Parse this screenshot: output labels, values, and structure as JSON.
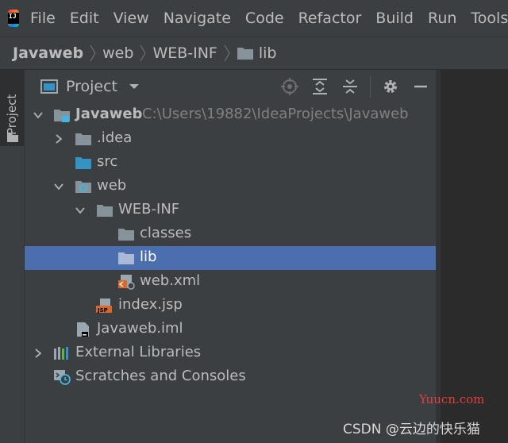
{
  "menubar": {
    "logo_text": "IJ",
    "items": [
      "File",
      "Edit",
      "View",
      "Navigate",
      "Code",
      "Refactor",
      "Build",
      "Run",
      "Tools"
    ]
  },
  "breadcrumbs": [
    "Javaweb",
    "web",
    "WEB-INF",
    "lib"
  ],
  "side_strip": {
    "tab_label": "Project"
  },
  "project_panel": {
    "title": "Project",
    "tools": [
      "locate-icon",
      "expand-all-icon",
      "collapse-all-icon",
      "settings-icon",
      "hide-icon"
    ]
  },
  "tree": {
    "root": {
      "label": "Javaweb",
      "path": "C:\\Users\\19882\\IdeaProjects\\Javaweb"
    },
    "idea": ".idea",
    "src": "src",
    "web": "web",
    "webinf": "WEB-INF",
    "classes": "classes",
    "lib": "lib",
    "webxml": "web.xml",
    "indexjsp": "index.jsp",
    "iml": "Javaweb.iml",
    "extlibs": "External Libraries",
    "scratches": "Scratches and Consoles"
  },
  "colors": {
    "selection": "#4b6eaf",
    "panel_bg": "#3c3f41",
    "folder": "#87939a",
    "module_blue": "#40b6e0",
    "jsp_orange": "#d9682b"
  },
  "watermarks": {
    "site": "Yuucn.com",
    "author": "CSDN @云边的快乐猫"
  }
}
